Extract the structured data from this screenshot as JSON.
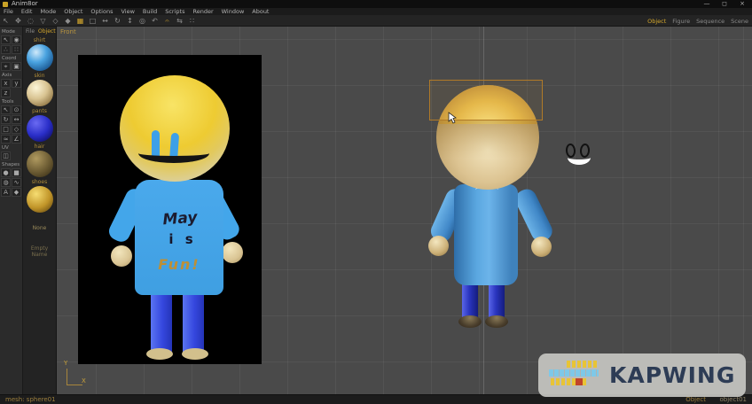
{
  "window": {
    "title": "Anim8or",
    "controls": {
      "minimize": "—",
      "restore": "◻",
      "close": "×"
    }
  },
  "menubar": {
    "items": [
      "File",
      "Edit",
      "Mode",
      "Object",
      "Options",
      "View",
      "Build",
      "Scripts",
      "Render",
      "Window",
      "About"
    ]
  },
  "toolbar": {
    "icons": [
      {
        "name": "pointer-icon",
        "glyph": "↖"
      },
      {
        "name": "pan-icon",
        "glyph": "✥"
      },
      {
        "name": "zoom-icon",
        "glyph": "◌"
      },
      {
        "name": "wireframe-icon",
        "glyph": "▽"
      },
      {
        "name": "flat-shaded-icon",
        "glyph": "◇"
      },
      {
        "name": "smooth-shaded-icon",
        "glyph": "◆"
      },
      {
        "name": "grid-snap-icon",
        "glyph": "▦"
      },
      {
        "name": "select-icon",
        "glyph": "□"
      },
      {
        "name": "move-icon",
        "glyph": "↔"
      },
      {
        "name": "rotate-icon",
        "glyph": "↻"
      },
      {
        "name": "scale-icon",
        "glyph": "↕"
      },
      {
        "name": "uniform-scale-icon",
        "glyph": "◎"
      },
      {
        "name": "undo-icon",
        "glyph": "↶"
      },
      {
        "name": "key-icon",
        "glyph": "𝄐"
      },
      {
        "name": "mirror-icon",
        "glyph": "⇆"
      },
      {
        "name": "subdivide-icon",
        "glyph": "∷"
      }
    ],
    "mode_tabs": [
      {
        "label": "Object",
        "active": true
      },
      {
        "label": "Figure",
        "active": false
      },
      {
        "label": "Sequence",
        "active": false
      },
      {
        "label": "Scene",
        "active": false
      }
    ]
  },
  "left_toolbar": {
    "sections": [
      {
        "label": "Mode",
        "icons": [
          {
            "name": "select-mode-icon",
            "glyph": "↖"
          },
          {
            "name": "view-eye-icon",
            "glyph": "◉"
          },
          {
            "name": "point-edit-icon",
            "glyph": "∴"
          },
          {
            "name": "axis-mode-icon",
            "glyph": "∷"
          }
        ]
      },
      {
        "label": "Coord",
        "icons": [
          {
            "name": "world-coord-icon",
            "glyph": "⌖"
          },
          {
            "name": "screen-coord-icon",
            "glyph": "▣"
          }
        ]
      },
      {
        "label": "Axis",
        "icons": [
          {
            "name": "axis-x-toggle",
            "glyph": "x"
          },
          {
            "name": "axis-y-toggle",
            "glyph": "y"
          },
          {
            "name": "axis-z-toggle",
            "glyph": "z"
          }
        ]
      },
      {
        "label": "Tools",
        "icons": [
          {
            "name": "arrow-tool-icon",
            "glyph": "↖"
          },
          {
            "name": "circle-select-icon",
            "glyph": "⊙"
          },
          {
            "name": "rotate-tool-icon",
            "glyph": "↻"
          },
          {
            "name": "drag-tool-icon",
            "glyph": "↔"
          },
          {
            "name": "rect-tool-icon",
            "glyph": "□"
          },
          {
            "name": "diamond-tool-icon",
            "glyph": "◇"
          },
          {
            "name": "curve-tool-icon",
            "glyph": "≈"
          },
          {
            "name": "angle-tool-icon",
            "glyph": "∠"
          }
        ]
      },
      {
        "label": "UV",
        "icons": [
          {
            "name": "uv-tool-icon",
            "glyph": "◫"
          }
        ]
      },
      {
        "label": "Shapes",
        "icons": [
          {
            "name": "sphere-shape-icon",
            "glyph": "●"
          },
          {
            "name": "cube-shape-icon",
            "glyph": "■"
          },
          {
            "name": "cylinder-shape-icon",
            "glyph": "◍"
          },
          {
            "name": "spline-shape-icon",
            "glyph": "∿"
          },
          {
            "name": "text-shape-icon",
            "glyph": "A"
          },
          {
            "name": "mesh-shape-icon",
            "glyph": "◆"
          }
        ]
      }
    ]
  },
  "materials": {
    "tabs": [
      {
        "label": "File",
        "active": false
      },
      {
        "label": "Object",
        "active": true
      }
    ],
    "items": [
      {
        "name": "shirt",
        "color": "#4aa3e0"
      },
      {
        "name": "skin",
        "color": "#d8c391"
      },
      {
        "name": "pants",
        "color": "#2a2ec8"
      },
      {
        "name": "hair",
        "color": "#6a5a32"
      },
      {
        "name": "shoes",
        "color": "#c09428"
      }
    ],
    "footer": "None",
    "footer2": "Empty Name"
  },
  "viewport": {
    "view_label": "Front",
    "axis": {
      "x": "X",
      "y": "Y"
    },
    "background": "#4a4a4a"
  },
  "reference_image": {
    "shirt_text_line1": "May",
    "shirt_text_line2": "i s",
    "shirt_text_line3": "Fun!"
  },
  "statusbar": {
    "left": "mesh: sphere01",
    "right_label": "Object",
    "right_value": "object01"
  },
  "watermark": {
    "text": "KAPWING"
  },
  "colors": {
    "accent_gold": "#c9a227",
    "viewport_bg": "#4a4a4a",
    "panel_bg": "#2b2b2b",
    "selection_box": "#b07a28",
    "shirt_blue": "#43a6ea",
    "pants_blue": "#2a35bf",
    "skin_tan": "#d8c391",
    "hair_gold": "#e8bb4a",
    "watermark_text": "#2d3c55"
  }
}
